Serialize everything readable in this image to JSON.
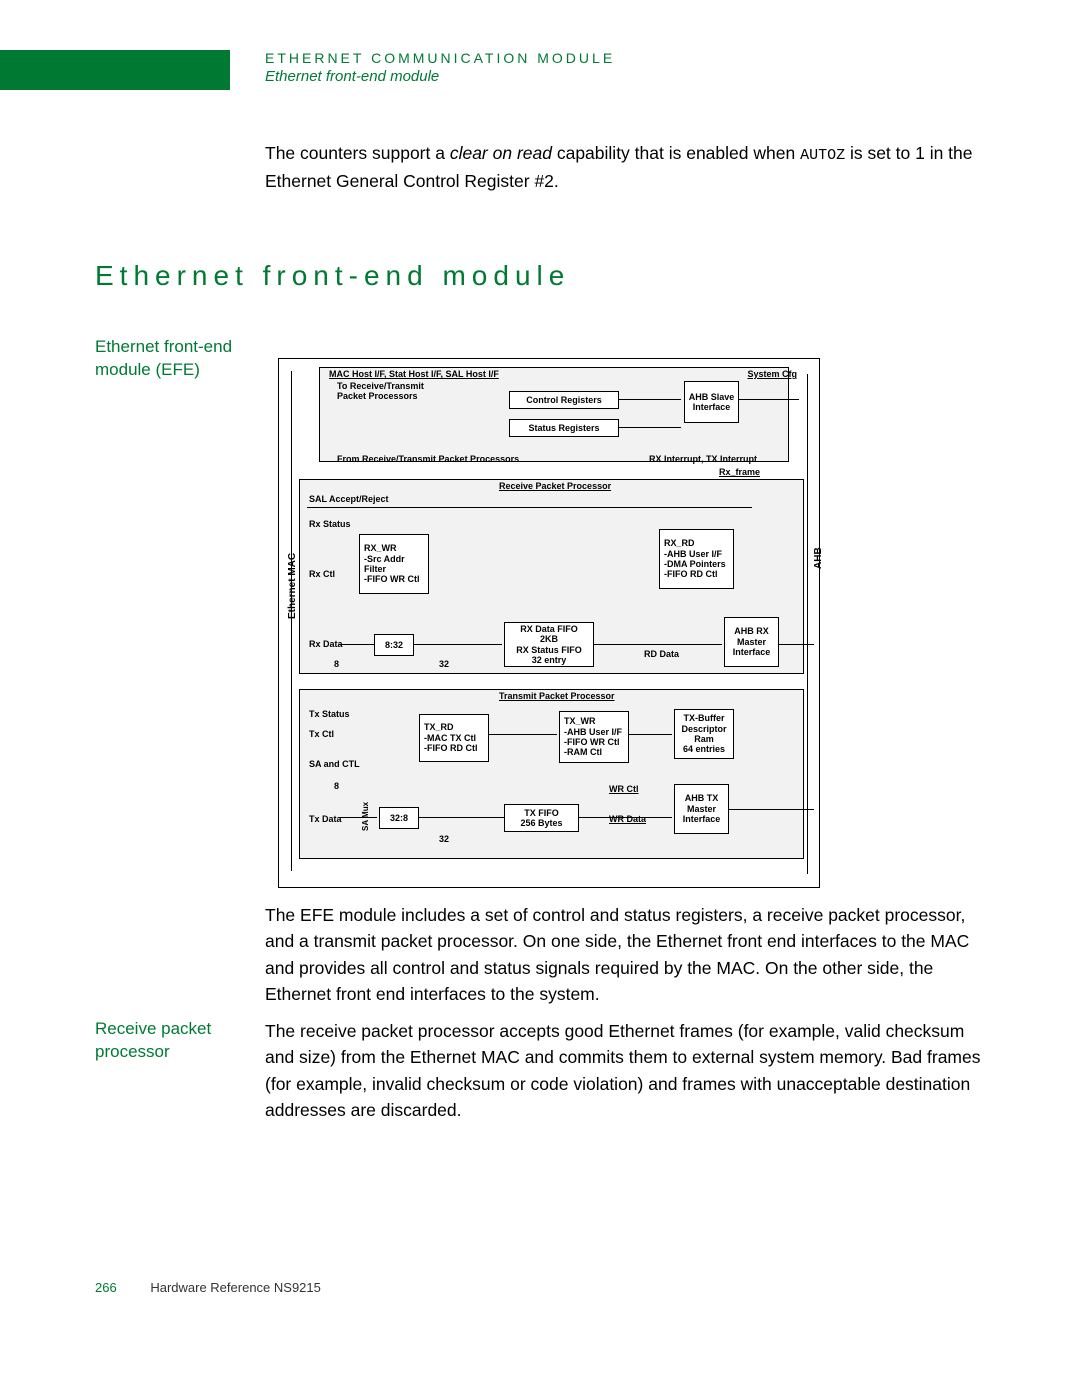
{
  "header": {
    "line1": "ETHERNET COMMUNICATION MODULE",
    "line2": "Ethernet front-end module"
  },
  "paragraphs": {
    "intro_pre": "The counters support a ",
    "intro_em": "clear on read",
    "intro_mid": " capability that is enabled when ",
    "intro_code": "AUTOZ",
    "intro_post": " is set to 1 in the Ethernet General Control Register #2.",
    "efe_desc": "The EFE module includes a set of control and status registers, a receive packet processor, and a transmit packet processor. On one side, the Ethernet front end interfaces to the MAC and provides all control and status signals required by the MAC. On the other side, the Ethernet front end interfaces to the system.",
    "rpp_desc": "The receive packet processor accepts good Ethernet frames (for example, valid checksum and size) from the Ethernet MAC and commits them to external system memory. Bad frames (for example, invalid checksum or code violation) and frames with unacceptable destination addresses are discarded."
  },
  "section_title": "Ethernet front-end module",
  "subheadings": {
    "efe": "Ethernet front-end module (EFE)",
    "rpp": "Receive packet processor"
  },
  "diagram": {
    "top_label": "MAC Host I/F, Stat Host I/F, SAL Host I/F",
    "system_cfg": "System Cfg",
    "to_rx_tx": "To Receive/Transmit Packet Processors",
    "ctrl_regs": "Control Registers",
    "status_regs": "Status Registers",
    "ahb_slave": "AHB Slave Interface",
    "from_rx_tx": "From Receive/Transmit Packet Processors",
    "rx_tx_int": "RX Interrupt, TX Interrupt",
    "rx_frame": "Rx_frame",
    "rpp_title": "Receive Packet Processor",
    "sal_accept": "SAL Accept/Reject",
    "rx_status": "Rx Status",
    "rx_ctl": "Rx Ctl",
    "rx_data": "Rx Data",
    "rx_wr": "RX_WR",
    "rx_wr_l1": "-Src Addr Filter",
    "rx_wr_l2": "-FIFO WR Ctl",
    "rx_rd": "RX_RD",
    "rx_rd_l1": "-AHB User I/F",
    "rx_rd_l2": "-DMA Pointers",
    "rx_rd_l3": "-FIFO RD Ctl",
    "rx_832": "8:32",
    "rx_8": "8",
    "rx_32": "32",
    "rx_fifo_l1": "RX Data FIFO",
    "rx_fifo_l2": "2KB",
    "rx_fifo_l3": "RX Status FIFO",
    "rx_fifo_l4": "32 entry",
    "rd_data": "RD Data",
    "ahb_rx": "AHB RX Master Interface",
    "ahb_label": "AHB",
    "eth_mac": "Ethernet MAC",
    "tpp_title": "Transmit Packet Processor",
    "tx_status": "Tx Status",
    "tx_ctl": "Tx Ctl",
    "sa_ctl": "SA and CTL",
    "tx_data": "Tx Data",
    "tx_8": "8",
    "tx_32": "32",
    "tx_328": "32:8",
    "tx_rd": "TX_RD",
    "tx_rd_l1": "-MAC TX Ctl",
    "tx_rd_l2": "-FIFO RD Ctl",
    "tx_wr": "TX_WR",
    "tx_wr_l1": "-AHB User I/F",
    "tx_wr_l2": "-FIFO WR Ctl",
    "tx_wr_l3": "-RAM Ctl",
    "tx_fifo_l1": "TX FIFO",
    "tx_fifo_l2": "256 Bytes",
    "wr_ctl": "WR Ctl",
    "wr_data": "WR Data",
    "tx_buf_l1": "TX-Buffer",
    "tx_buf_l2": "Descriptor",
    "tx_buf_l3": "Ram",
    "tx_buf_l4": "64 entries",
    "ahb_tx": "AHB TX Master Interface",
    "sa_mux": "SA Mux"
  },
  "footer": {
    "page": "266",
    "doc": "Hardware Reference NS9215"
  }
}
